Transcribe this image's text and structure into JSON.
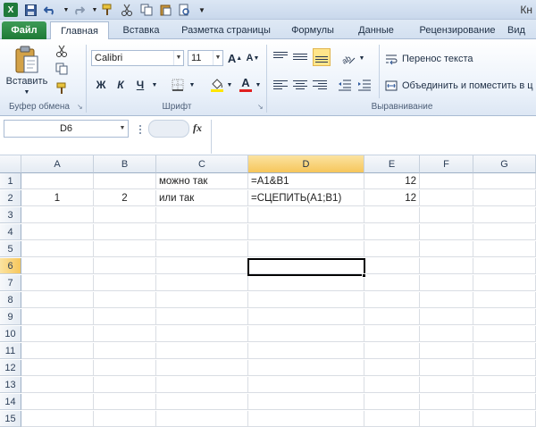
{
  "titlebar": {
    "app_icon": "X",
    "title": "Кн",
    "icons": [
      "excel-app-icon",
      "save-icon",
      "undo-icon",
      "redo-icon",
      "cut-icon",
      "copy-icon",
      "paste-icon",
      "customize-icon"
    ]
  },
  "tabs": [
    {
      "label": "Файл"
    },
    {
      "label": "Главная"
    },
    {
      "label": "Вставка"
    },
    {
      "label": "Разметка страницы"
    },
    {
      "label": "Формулы"
    },
    {
      "label": "Данные"
    },
    {
      "label": "Рецензирование"
    },
    {
      "label": "Вид"
    }
  ],
  "ribbon": {
    "clipboard": {
      "paste": "Вставить",
      "label": "Буфер обмена"
    },
    "font": {
      "name": "Calibri",
      "size": "11",
      "bold": "Ж",
      "italic": "К",
      "underline": "Ч",
      "grow": "A",
      "shrink": "A",
      "font_color": "A",
      "label": "Шрифт"
    },
    "alignment": {
      "wrap": "Перенос текста",
      "merge": "Объединить и поместить в ц",
      "label": "Выравнивание"
    }
  },
  "formula_bar": {
    "name_box": "D6",
    "fx": "fx",
    "formula": ""
  },
  "columns": [
    "A",
    "B",
    "C",
    "D",
    "E",
    "F",
    "G"
  ],
  "selected_column": "D",
  "rows": [
    {
      "n": "1",
      "cells": {
        "A": "",
        "B": "",
        "C": "можно так",
        "D": "=A1&B1",
        "E": "12",
        "F": "",
        "G": ""
      }
    },
    {
      "n": "2",
      "cells": {
        "A": "1",
        "B": "2",
        "C": "или так",
        "D": "=СЦЕПИТЬ(A1;B1)",
        "E": "12",
        "F": "",
        "G": ""
      }
    },
    {
      "n": "3",
      "cells": {}
    },
    {
      "n": "4",
      "cells": {}
    },
    {
      "n": "5",
      "cells": {}
    },
    {
      "n": "6",
      "cells": {}
    },
    {
      "n": "7",
      "cells": {}
    },
    {
      "n": "8",
      "cells": {}
    },
    {
      "n": "9",
      "cells": {}
    },
    {
      "n": "10",
      "cells": {}
    },
    {
      "n": "11",
      "cells": {}
    },
    {
      "n": "12",
      "cells": {}
    },
    {
      "n": "13",
      "cells": {}
    },
    {
      "n": "14",
      "cells": {}
    },
    {
      "n": "15",
      "cells": {}
    }
  ],
  "selected_row": "6",
  "active_cell": "D6"
}
